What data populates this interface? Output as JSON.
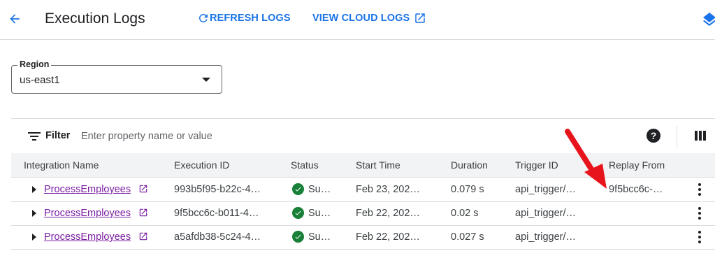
{
  "header": {
    "title": "Execution Logs",
    "refresh_label": "REFRESH LOGS",
    "cloud_logs_label": "VIEW CLOUD LOGS"
  },
  "region": {
    "label": "Region",
    "value": "us-east1"
  },
  "filter": {
    "label": "Filter",
    "placeholder": "Enter property name or value"
  },
  "table": {
    "columns": [
      "Integration Name",
      "Execution ID",
      "Status",
      "Start Time",
      "Duration",
      "Trigger ID",
      "Replay From"
    ],
    "rows": [
      {
        "integration": "ProcessEmployees",
        "execution_id": "993b5f95-b22c-4…",
        "status": "Su…",
        "start_time": "Feb 23, 202…",
        "duration": "0.079 s",
        "trigger_id": "api_trigger/…",
        "replay_from": "9f5bcc6c-…"
      },
      {
        "integration": "ProcessEmployees",
        "execution_id": "9f5bcc6c-b011-4…",
        "status": "Su…",
        "start_time": "Feb 22, 202…",
        "duration": "0.02 s",
        "trigger_id": "api_trigger/…",
        "replay_from": ""
      },
      {
        "integration": "ProcessEmployees",
        "execution_id": "a5afdb38-5c24-4…",
        "status": "Su…",
        "start_time": "Feb 22, 202…",
        "duration": "0.027 s",
        "trigger_id": "api_trigger/…",
        "replay_from": ""
      }
    ]
  },
  "colors": {
    "accent": "#1a73e8",
    "link": "#7b1fa2",
    "success": "#188038",
    "annotation_arrow": "#e8141c"
  },
  "icons": [
    "back-arrow-icon",
    "refresh-icon",
    "open-in-new-icon",
    "layers-icon",
    "filter-icon",
    "help-icon",
    "columns-icon",
    "expand-arrow-icon",
    "check-circle-icon",
    "more-vert-icon"
  ]
}
